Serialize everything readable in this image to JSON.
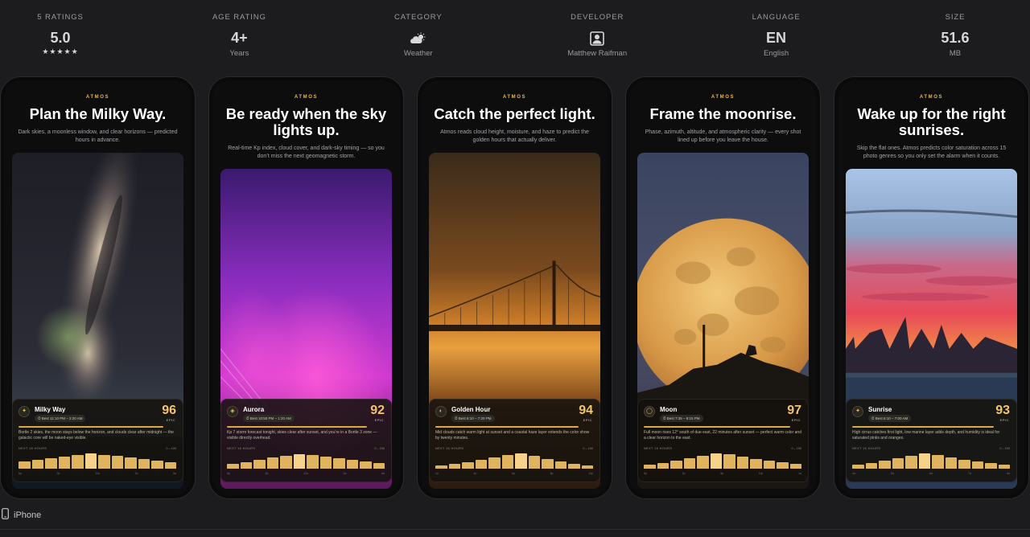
{
  "info": [
    {
      "label": "5 RATINGS",
      "value": "5.0",
      "stars": "★★★★★",
      "sub": ""
    },
    {
      "label": "AGE RATING",
      "value": "4+",
      "sub": "Years"
    },
    {
      "label": "CATEGORY",
      "icon": "weather-icon",
      "sub": "Weather"
    },
    {
      "label": "DEVELOPER",
      "icon": "developer-icon",
      "sub": "Matthew Raifman"
    },
    {
      "label": "LANGUAGE",
      "value": "EN",
      "sub": "English"
    },
    {
      "label": "SIZE",
      "value": "51.6",
      "sub": "MB"
    }
  ],
  "brand": "ATMOS",
  "screenshots": [
    {
      "headline": "Plan the Milky Way.",
      "subline": "Dark skies, a moonless window, and clear horizons — predicted hours in advance.",
      "card": {
        "icon": "✦",
        "title": "Milky Way",
        "time": "⏱ Best 11:10 PM – 2:20 AM",
        "score": "96",
        "epic": "EPIC",
        "desc": "Bortle 2 skies, the moon stays below the horizon, and clouds clear after midnight — the galactic core will be naked-eye visible.",
        "next": "NEXT 16 HOURS",
        "range": "0 – 100",
        "bars": [
          0.45,
          0.55,
          0.65,
          0.75,
          0.85,
          0.95,
          0.85,
          0.8,
          0.7,
          0.6,
          0.5,
          0.4
        ],
        "peak": 5,
        "ticks": [
          "6p",
          "9p",
          "12a",
          "3a",
          "6a"
        ]
      }
    },
    {
      "headline": "Be ready when the sky lights up.",
      "subline": "Real-time Kp index, cloud cover, and dark-sky timing — so you don’t miss the next geomagnetic storm.",
      "card": {
        "icon": "◈",
        "title": "Aurora",
        "time": "⏱ Best 10:50 PM – 1:20 AM",
        "score": "92",
        "epic": "EPIC",
        "desc": "Kp 7 storm forecast tonight, skies clear after sunset, and you’re in a Bortle 3 zone — visible directly overhead.",
        "next": "NEXT 16 HOURS",
        "range": "0 – 100",
        "bars": [
          0.3,
          0.4,
          0.55,
          0.7,
          0.8,
          0.9,
          0.85,
          0.75,
          0.65,
          0.55,
          0.45,
          0.35
        ],
        "peak": 5,
        "ticks": [
          "6p",
          "9p",
          "12a",
          "3a",
          "6a"
        ]
      }
    },
    {
      "headline": "Catch the perfect light.",
      "subline": "Atmos reads cloud height, moisture, and haze to predict the golden hours that actually deliver.",
      "card": {
        "icon": "◐",
        "title": "Golden Hour",
        "time": "⏱ Best 6:10 – 7:20 PM",
        "score": "94",
        "epic": "EPIC",
        "desc": "Mid clouds catch warm light at sunset and a coastal haze layer extends the color show by twenty minutes.",
        "next": "NEXT 16 HOURS",
        "range": "0 – 100",
        "bars": [
          0.2,
          0.3,
          0.4,
          0.55,
          0.7,
          0.85,
          0.95,
          0.8,
          0.6,
          0.45,
          0.3,
          0.2
        ],
        "peak": 6,
        "ticks": [
          "2p",
          "4p",
          "6p",
          "8p",
          "10p"
        ]
      }
    },
    {
      "headline": "Frame the moonrise.",
      "subline": "Phase, azimuth, altitude, and atmospheric clarity — every shot lined up before you leave the house.",
      "card": {
        "icon": "◯",
        "title": "Moon",
        "time": "⏱ Best 7:35 – 8:15 PM",
        "score": "97",
        "epic": "EPIC",
        "desc": "Full moon rises 12° south of due east, 22 minutes after sunset — perfect warm color and a clear horizon to the east.",
        "next": "NEXT 16 HOURS",
        "range": "0 – 100",
        "bars": [
          0.25,
          0.35,
          0.5,
          0.65,
          0.8,
          0.95,
          0.9,
          0.75,
          0.6,
          0.5,
          0.4,
          0.3
        ],
        "peak": 5,
        "ticks": [
          "5p",
          "7p",
          "9p",
          "11p",
          "1a"
        ]
      }
    },
    {
      "headline": "Wake up for the right sunrises.",
      "subline": "Skip the flat ones. Atmos predicts color saturation across 15 photo genres so you only set the alarm when it counts.",
      "card": {
        "icon": "✦",
        "title": "Sunrise",
        "time": "⏱ Best 6:10 – 7:00 AM",
        "score": "93",
        "epic": "EPIC",
        "desc": "High cirrus catches first light, low marine layer adds depth, and humidity is ideal for saturated pinks and oranges.",
        "next": "NEXT 16 HOURS",
        "range": "0 – 100",
        "bars": [
          0.25,
          0.35,
          0.5,
          0.65,
          0.8,
          0.95,
          0.85,
          0.7,
          0.55,
          0.45,
          0.35,
          0.25
        ],
        "peak": 5,
        "ticks": [
          "4a",
          "5a",
          "6a",
          "7a",
          "8a"
        ]
      }
    }
  ],
  "footer": {
    "device_label": "iPhone",
    "icon": "iphone-icon"
  },
  "colors": {
    "accent": "#e8b44a",
    "background": "#1c1c1e",
    "score": "#f2c46c"
  }
}
